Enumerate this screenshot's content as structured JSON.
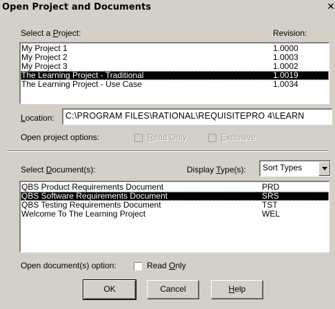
{
  "window": {
    "title": "Open Project and Documents",
    "close_glyph": "✕"
  },
  "project_section": {
    "select_label_pre": "Select a ",
    "select_label_key": "P",
    "select_label_post": "roject:",
    "revision_header": "Revision:",
    "projects": [
      {
        "name": "My Project 1",
        "revision": "1.0000",
        "selected": false
      },
      {
        "name": "My Project 2",
        "revision": "1.0003",
        "selected": false
      },
      {
        "name": "My Project 3",
        "revision": "1.0002",
        "selected": false
      },
      {
        "name": "The Learning Project - Traditional",
        "revision": "1.0019",
        "selected": true
      },
      {
        "name": "The Learning Project - Use Case",
        "revision": "1.0034",
        "selected": false
      }
    ],
    "location_label_key": "L",
    "location_label_post": "ocation:",
    "location_value": "C:\\PROGRAM FILES\\RATIONAL\\REQUISITEPRO 4\\LEARN",
    "options_label": "Open project options:",
    "read_only_key": "R",
    "read_only_post": "ead Only",
    "exclusive_key": "E",
    "exclusive_post": "xclusive"
  },
  "document_section": {
    "select_label_pre": "Select ",
    "select_label_key": "D",
    "select_label_post": "ocument(s):",
    "display_label_pre": "Display ",
    "display_label_key": "T",
    "display_label_post": "ype(s):",
    "display_type_value": "Sort Types",
    "documents": [
      {
        "name": "QBS Product Requirements Document",
        "type": "PRD",
        "selected": false
      },
      {
        "name": "QBS Software Requirements Document",
        "type": "SRS",
        "selected": true
      },
      {
        "name": "QBS Testing Requirements Document",
        "type": "TST",
        "selected": false
      },
      {
        "name": "Welcome To The Learning Project",
        "type": "WEL",
        "selected": false
      }
    ],
    "doc_option_label": "Open document(s) option:",
    "read_only_pre": "Read ",
    "read_only_key": "O",
    "read_only_post": "nly"
  },
  "buttons": {
    "ok": "OK",
    "cancel": "Cancel",
    "help_key": "H",
    "help_post": "elp"
  }
}
